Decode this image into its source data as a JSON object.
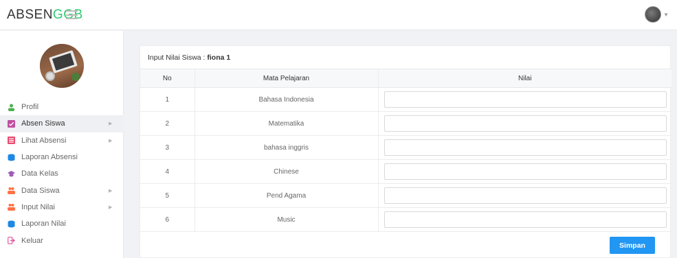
{
  "brand": {
    "part1": "ABSEN",
    "part2": "GGB"
  },
  "colors": {
    "accent": "#2ecc71",
    "button": "#2196f3"
  },
  "sidebar": {
    "items": [
      {
        "label": "Profil",
        "icon": "user-icon",
        "active": false,
        "has_arrow": false
      },
      {
        "label": "Absen Siswa",
        "icon": "check-square-icon",
        "active": true,
        "has_arrow": true
      },
      {
        "label": "Lihat Absensi",
        "icon": "list-icon",
        "active": false,
        "has_arrow": true
      },
      {
        "label": "Laporan Absensi",
        "icon": "database-icon",
        "active": false,
        "has_arrow": false
      },
      {
        "label": "Data Kelas",
        "icon": "graduation-cap-icon",
        "active": false,
        "has_arrow": false
      },
      {
        "label": "Data Siswa",
        "icon": "users-icon",
        "active": false,
        "has_arrow": true
      },
      {
        "label": "Input Nilai",
        "icon": "users-icon",
        "active": false,
        "has_arrow": true
      },
      {
        "label": "Laporan Nilai",
        "icon": "database-icon",
        "active": false,
        "has_arrow": false
      },
      {
        "label": "Keluar",
        "icon": "sign-out-icon",
        "active": false,
        "has_arrow": false
      }
    ]
  },
  "panel": {
    "title_prefix": "Input Nilai Siswa : ",
    "title_name": "fiona 1",
    "columns": [
      "No",
      "Mata Pelajaran",
      "Nilai"
    ],
    "rows": [
      {
        "no": "1",
        "subject": "Bahasa Indonesia",
        "value": ""
      },
      {
        "no": "2",
        "subject": "Matematika",
        "value": ""
      },
      {
        "no": "3",
        "subject": "bahasa inggris",
        "value": ""
      },
      {
        "no": "4",
        "subject": "Chinese",
        "value": ""
      },
      {
        "no": "5",
        "subject": "Pend Agama",
        "value": ""
      },
      {
        "no": "6",
        "subject": "Music",
        "value": ""
      }
    ],
    "submit_label": "Simpan"
  }
}
